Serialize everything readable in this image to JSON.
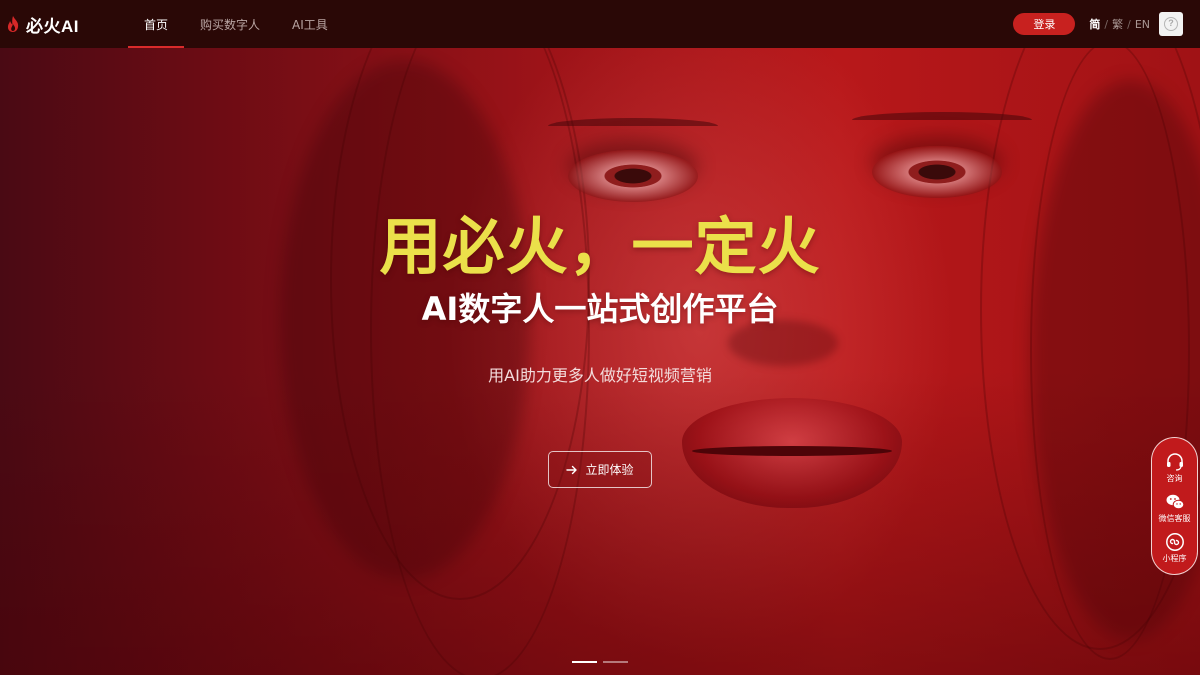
{
  "brand": {
    "name": "必火AI",
    "accent_color": "#c8211f"
  },
  "nav": {
    "links": [
      {
        "label": "首页",
        "active": true
      },
      {
        "label": "购买数字人",
        "active": false
      },
      {
        "label": "AI工具",
        "active": false
      }
    ],
    "login_label": "登录",
    "languages": [
      {
        "label": "简",
        "active": true
      },
      {
        "label": "繁",
        "active": false
      },
      {
        "label": "EN",
        "active": false
      }
    ],
    "avatar_icon": "help-icon"
  },
  "hero": {
    "headline": "用必火，一定火",
    "headline_color": "#ebe04a",
    "subheadline": "AI数字人一站式创作平台",
    "tagline": "用AI助力更多人做好短视频营销",
    "cta_label": "立即体验",
    "cta_icon": "arrow-right-icon"
  },
  "float_bar": {
    "items": [
      {
        "label": "咨询",
        "icon": "headset-icon"
      },
      {
        "label": "微信客服",
        "icon": "wechat-icon"
      },
      {
        "label": "小程序",
        "icon": "mini-program-icon"
      }
    ]
  },
  "carousel": {
    "slide_count": 2,
    "active_index": 0
  }
}
